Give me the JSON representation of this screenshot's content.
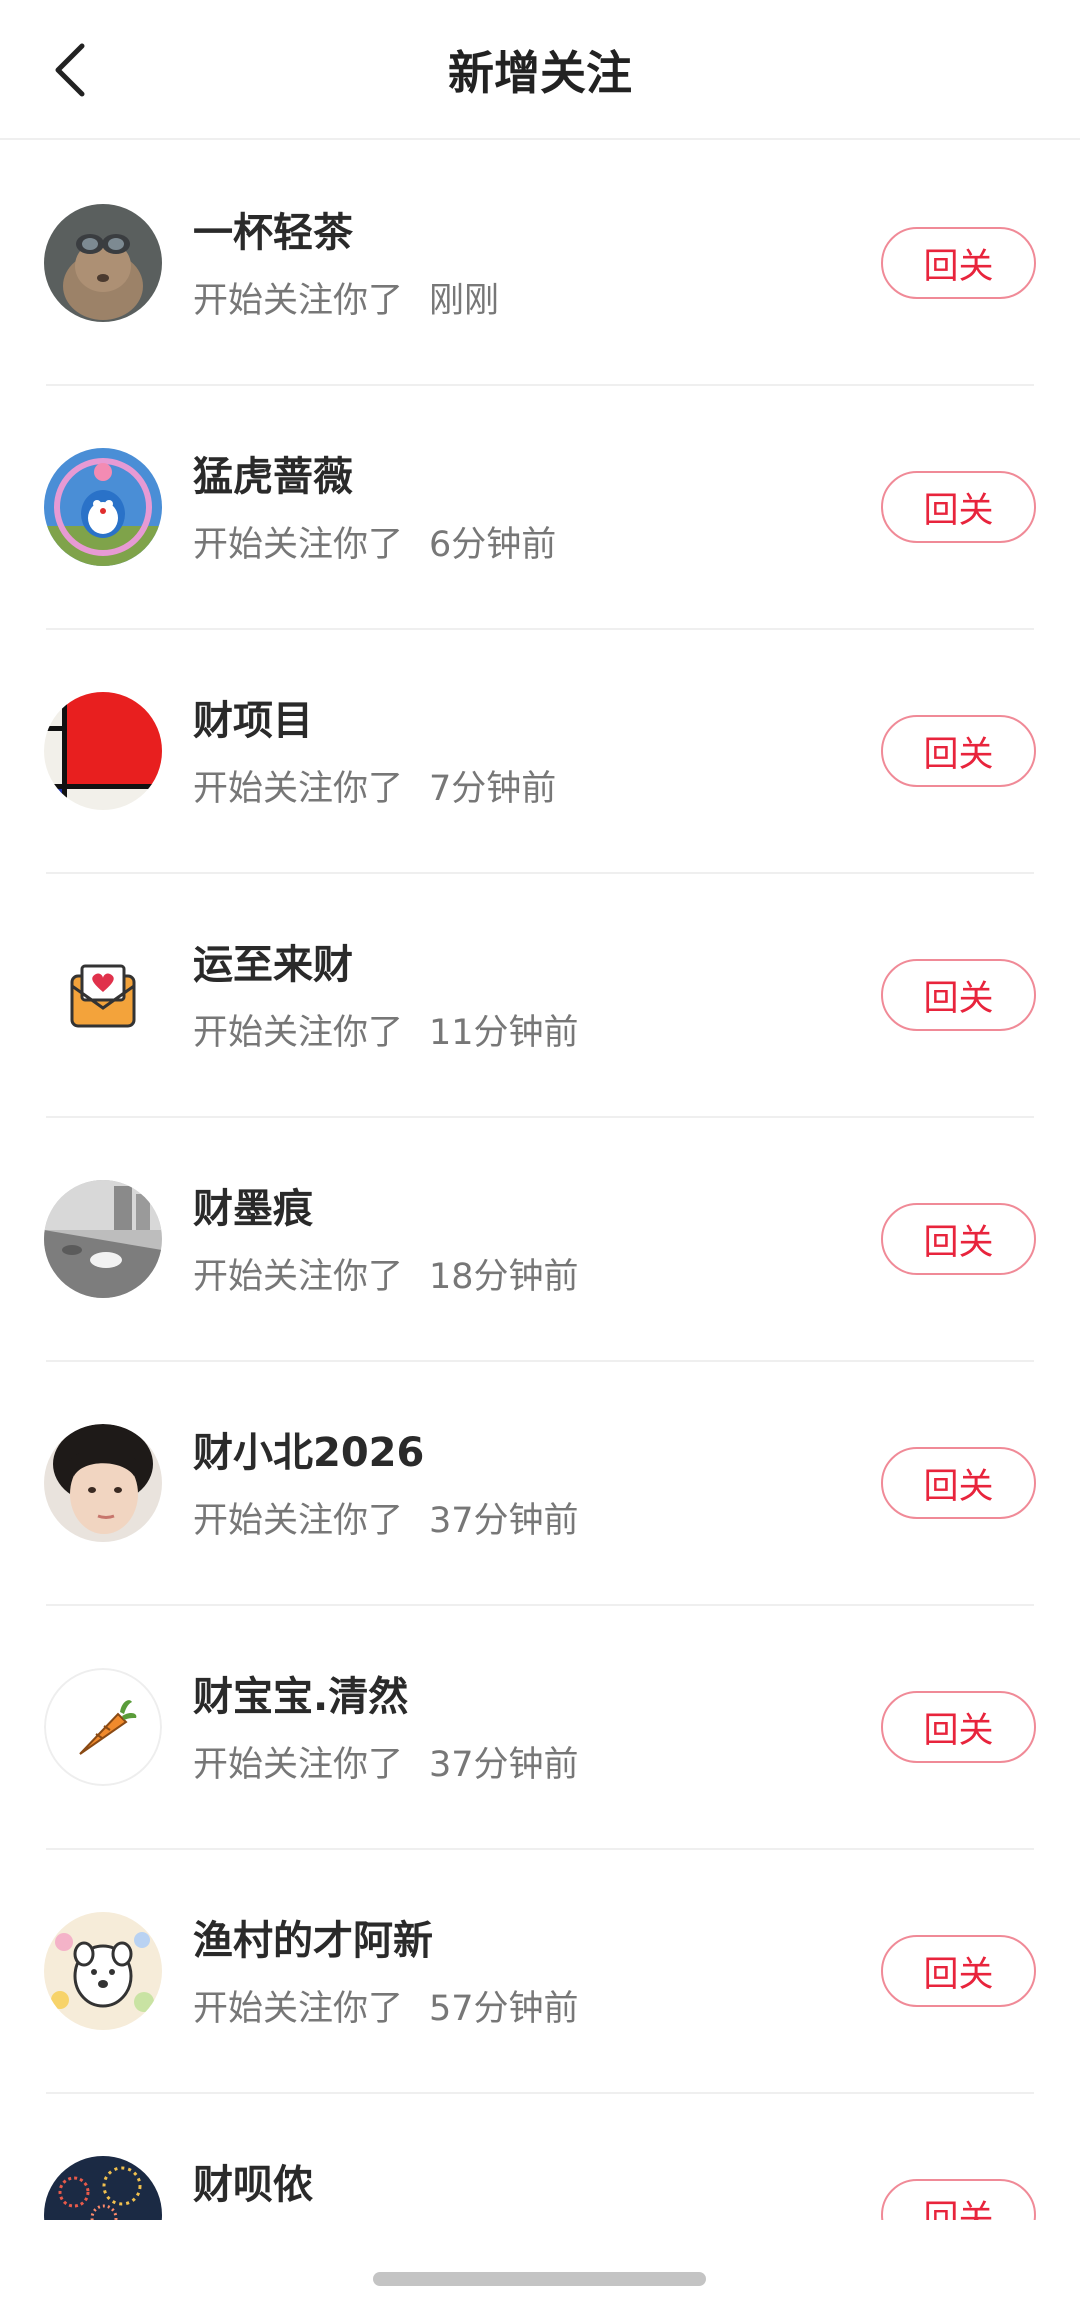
{
  "header": {
    "title": "新增关注",
    "back_icon": "chevron-left-icon"
  },
  "meta_text": "开始关注你了",
  "follow_label": "回关",
  "colors": {
    "accent": "#e8243c",
    "accent_border": "#f08a97",
    "divider": "#efefef"
  },
  "items": [
    {
      "name": "一杯轻茶",
      "time": "刚刚",
      "avatar": "rabbit-with-goggles-avatar"
    },
    {
      "name": "猛虎蔷薇",
      "time": "6分钟前",
      "avatar": "doraemon-avatar"
    },
    {
      "name": "财项目",
      "time": "7分钟前",
      "avatar": "mondrian-red-avatar"
    },
    {
      "name": "运至来财",
      "time": "11分钟前",
      "avatar": "heart-envelope-avatar"
    },
    {
      "name": "财墨痕",
      "time": "18分钟前",
      "avatar": "street-photo-avatar"
    },
    {
      "name": "财小北2026",
      "time": "37分钟前",
      "avatar": "girl-portrait-avatar"
    },
    {
      "name": "财宝宝.清然",
      "time": "37分钟前",
      "avatar": "carrot-avatar"
    },
    {
      "name": "渔村的才阿新",
      "time": "57分钟前",
      "avatar": "flower-cartoon-avatar"
    },
    {
      "name": "财呗侬",
      "time": "",
      "avatar": "fireworks-avatar"
    }
  ]
}
